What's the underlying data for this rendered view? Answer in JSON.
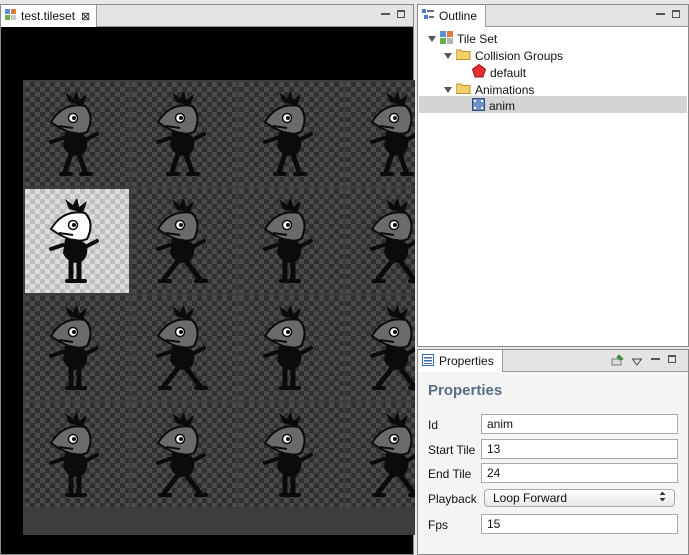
{
  "editor": {
    "tab_title": "test.tileset",
    "close_glyph": "⊠"
  },
  "outline": {
    "title": "Outline",
    "items": [
      {
        "label": "Tile Set",
        "icon": "tileset-icon"
      },
      {
        "label": "Collision Groups",
        "icon": "folder-icon"
      },
      {
        "label": "default",
        "icon": "collision-group-icon"
      },
      {
        "label": "Animations",
        "icon": "folder-icon"
      },
      {
        "label": "anim",
        "icon": "animation-icon",
        "selected": true
      }
    ]
  },
  "properties": {
    "tab_title": "Properties",
    "heading": "Properties",
    "fields": {
      "id": {
        "label": "Id",
        "value": "anim"
      },
      "start_tile": {
        "label": "Start Tile",
        "value": "13"
      },
      "end_tile": {
        "label": "End Tile",
        "value": "24"
      },
      "playback": {
        "label": "Playback",
        "value": "Loop Forward"
      },
      "fps": {
        "label": "Fps",
        "value": "15"
      }
    }
  },
  "tileset": {
    "rows": 4,
    "columns": 4,
    "selected_tile": 5
  },
  "colors": {
    "heading": "#5a6d86",
    "selection": "#d4d4d4",
    "collision": "#e23030"
  }
}
